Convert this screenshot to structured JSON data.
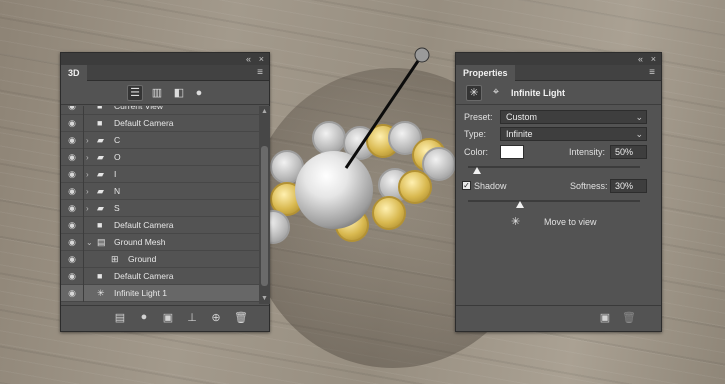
{
  "panel3d": {
    "tab_label": "3D",
    "collapse_glyph": "«",
    "close_glyph": "×",
    "menu_glyph": "≡",
    "filter_icons": [
      "scene-filter-icon",
      "mesh-filter-icon",
      "material-filter-icon",
      "light-filter-icon"
    ],
    "rows": [
      {
        "label": "Current View",
        "icon": "camera-icon",
        "glyph": "■"
      },
      {
        "label": "Default Camera",
        "icon": "camera-icon",
        "glyph": "■"
      },
      {
        "label": "C",
        "icon": "folder-icon",
        "glyph": "▰",
        "expand": "›"
      },
      {
        "label": "O",
        "icon": "folder-icon",
        "glyph": "▰",
        "expand": "›"
      },
      {
        "label": "I",
        "icon": "folder-icon",
        "glyph": "▰",
        "expand": "›"
      },
      {
        "label": "N",
        "icon": "folder-icon",
        "glyph": "▰",
        "expand": "›"
      },
      {
        "label": "S",
        "icon": "folder-icon",
        "glyph": "▰",
        "expand": "›"
      },
      {
        "label": "Default Camera",
        "icon": "camera-icon",
        "glyph": "■"
      },
      {
        "label": "Ground Mesh",
        "icon": "mesh-icon",
        "glyph": "▤",
        "expand": "⌄"
      },
      {
        "label": "Ground",
        "icon": "material-icon",
        "glyph": "⊞"
      },
      {
        "label": "Default Camera",
        "icon": "camera-icon",
        "glyph": "■"
      },
      {
        "label": "Infinite Light 1",
        "icon": "infinite-light-icon",
        "glyph": "✳",
        "selected": true
      }
    ],
    "eye_glyph": "◉",
    "bottom_icons": [
      "mesh-preset-icon",
      "add-light-icon",
      "render-icon",
      "drop-to-plane-icon",
      "new-object-icon",
      "delete-icon"
    ]
  },
  "properties": {
    "tab_label": "Properties",
    "collapse_glyph": "«",
    "close_glyph": "×",
    "menu_glyph": "≡",
    "light_name": "Infinite Light",
    "preset_label": "Preset:",
    "preset_value": "Custom",
    "type_label": "Type:",
    "type_value": "Infinite",
    "color_label": "Color:",
    "intensity_label": "Intensity:",
    "intensity_value": "50%",
    "intensity_fraction": 0.5,
    "shadow_label": "Shadow",
    "shadow_checked": true,
    "softness_label": "Softness:",
    "softness_value": "30%",
    "softness_fraction": 0.3,
    "move_to_view_label": "Move to view",
    "colors": {
      "light_color": "#ffffff"
    }
  }
}
